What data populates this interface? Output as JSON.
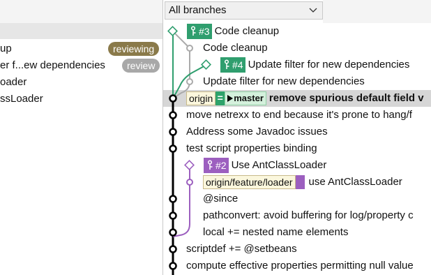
{
  "branch_selector": {
    "value": "All branches"
  },
  "sidebar": {
    "pull_requests": [
      {
        "label": "up",
        "badge": "reviewing",
        "badge_color": "#8a7a4a"
      },
      {
        "label": "er f...ew dependencies",
        "badge": "review",
        "badge_color": "#a8a8a8"
      },
      {
        "label": "oader",
        "badge": ""
      },
      {
        "label": "ssLoader",
        "badge": ""
      }
    ]
  },
  "colors": {
    "pr_green": "#2f9e6e",
    "pr_purple": "#9c5fbf",
    "main_line": "#000000",
    "side_line": "#aaaaaa"
  },
  "commits": [
    {
      "pr_number": "#3",
      "message": "Code cleanup",
      "pr_color": "#2f9e6e"
    },
    {
      "message": "Code cleanup"
    },
    {
      "pr_number": "#4",
      "message": "Update filter for new dependencies",
      "pr_color": "#2f9e6e"
    },
    {
      "message": "Update filter for new dependencies"
    },
    {
      "remote": "origin",
      "eq": "=",
      "branch": "master",
      "message": "remove spurious default field v"
    },
    {
      "message": "move netrexx to end because it's prone to hang/f"
    },
    {
      "message": "Address some Javadoc issues"
    },
    {
      "message": "test script properties binding"
    },
    {
      "pr_number": "#2",
      "message": "Use AntClassLoader",
      "pr_color": "#9c5fbf"
    },
    {
      "ref": "origin/feature/loader",
      "message": "use AntClassLoader"
    },
    {
      "message": "@since"
    },
    {
      "message": "pathconvert: avoid buffering for log/property c"
    },
    {
      "message": "local += nested name elements"
    },
    {
      "message": "scriptdef += @setbeans"
    },
    {
      "message": "compute effective properties permitting null value"
    }
  ]
}
